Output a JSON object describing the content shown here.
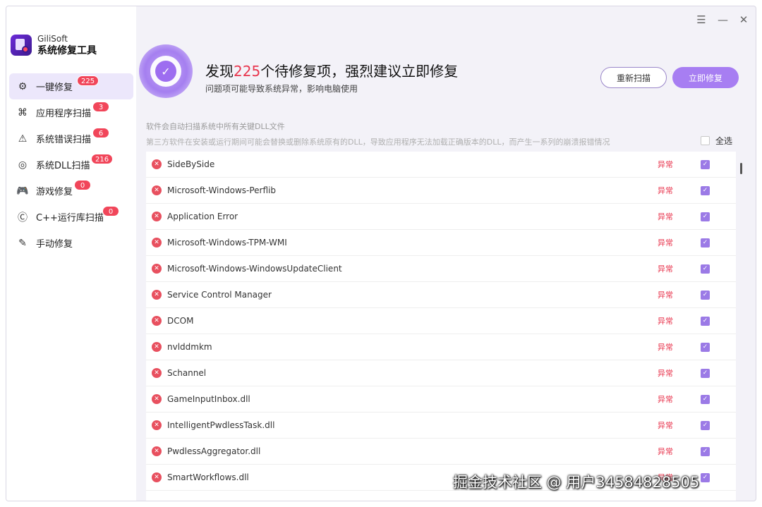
{
  "brand": {
    "name_en": "GiliSoft",
    "name_cn": "系统修复工具"
  },
  "window_controls": {
    "menu": "☰",
    "minimize": "—",
    "close": "✕"
  },
  "sidebar": {
    "items": [
      {
        "label": "一键修复",
        "badge": "225",
        "icon": "wrench-circle-icon",
        "glyph": "⚙"
      },
      {
        "label": "应用程序扫描",
        "badge": "3",
        "icon": "apps-scan-icon",
        "glyph": "⌘"
      },
      {
        "label": "系统错误扫描",
        "badge": "6",
        "icon": "warning-icon",
        "glyph": "⚠"
      },
      {
        "label": "系统DLL扫描",
        "badge": "216",
        "icon": "dll-target-icon",
        "glyph": "◎"
      },
      {
        "label": "游戏修复",
        "badge": "0",
        "icon": "gamepad-icon",
        "glyph": "🎮"
      },
      {
        "label": "C++运行库扫描",
        "badge": "0",
        "icon": "cpp-icon",
        "glyph": "Ⓒ"
      },
      {
        "label": "手动修复",
        "badge": "",
        "icon": "manual-fix-icon",
        "glyph": "✎"
      }
    ]
  },
  "header": {
    "title_prefix": "发现",
    "title_count": "225",
    "title_suffix": "个待修复项，强烈建议立即修复",
    "subtitle": "问题项可能导致系统异常，影响电脑使用",
    "rescan_label": "重新扫描",
    "fix_label": "立即修复"
  },
  "info": {
    "line1": "软件会自动扫描系统中所有关键DLL文件",
    "line2": "第三方软件在安装或运行期间可能会替换或删除系统原有的DLL，导致应用程序无法加载正确版本的DLL，而产生一系列的崩溃报错情况",
    "select_all": "全选"
  },
  "list": {
    "status_text": "异常",
    "rows": [
      {
        "name": "SideBySide"
      },
      {
        "name": "Microsoft-Windows-Perflib"
      },
      {
        "name": "Application Error"
      },
      {
        "name": "Microsoft-Windows-TPM-WMI"
      },
      {
        "name": "Microsoft-Windows-WindowsUpdateClient"
      },
      {
        "name": "Service Control Manager"
      },
      {
        "name": "DCOM"
      },
      {
        "name": "nvlddmkm"
      },
      {
        "name": "Schannel"
      },
      {
        "name": "GameInputInbox.dll"
      },
      {
        "name": "IntelligentPwdlessTask.dll"
      },
      {
        "name": "PwdlessAggregator.dll"
      },
      {
        "name": "SmartWorkflows.dll"
      }
    ]
  },
  "watermark": "掘金技术社区 @ 用户3458482850​5",
  "colors": {
    "accent": "#a77ef2",
    "danger": "#e8364e",
    "badge": "#f1465a"
  }
}
